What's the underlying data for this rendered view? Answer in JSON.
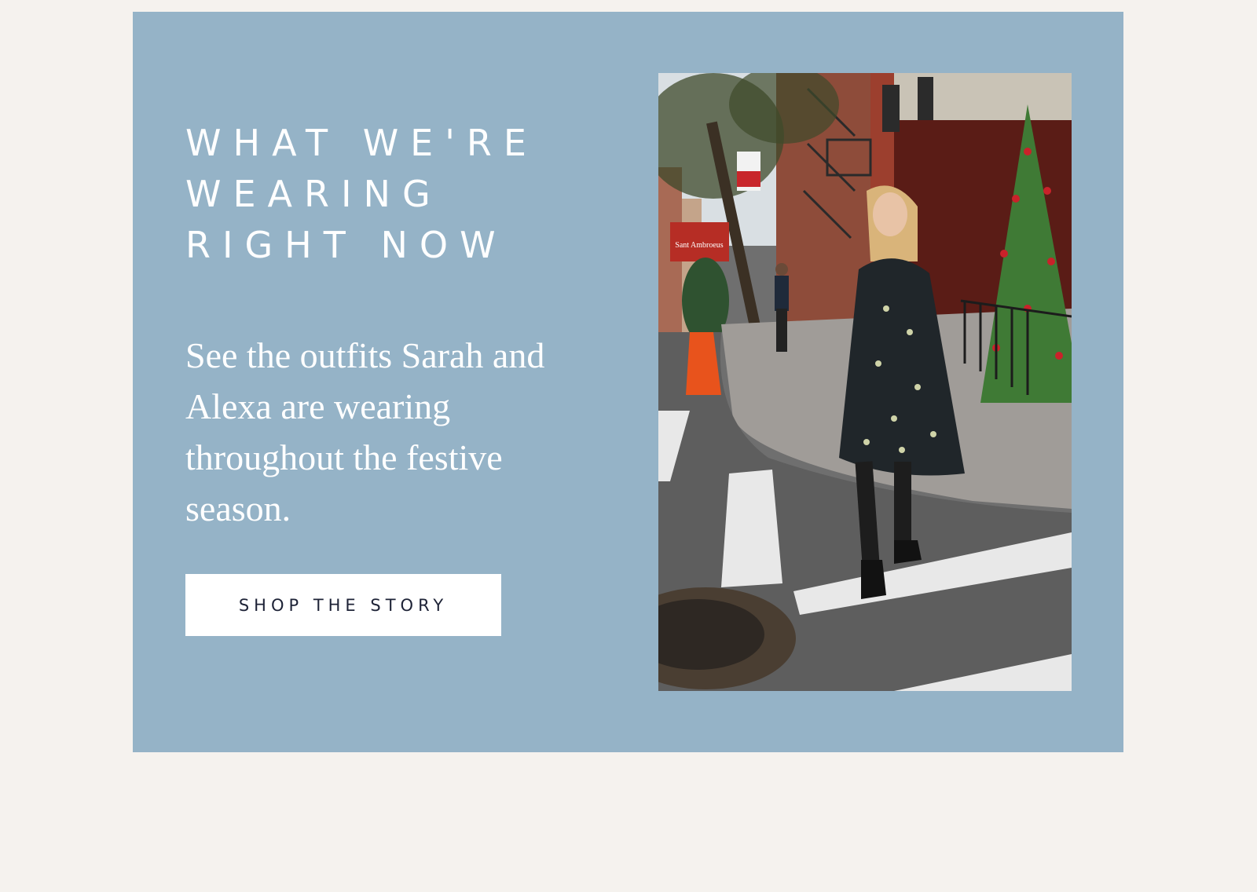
{
  "promo": {
    "heading_lines": [
      "WHAT WE'RE",
      "WEARING",
      "RIGHT NOW"
    ],
    "body": "See the outfits Sarah and Alexa are wearing throughout the festive season.",
    "button_label": "SHOP THE STORY"
  },
  "photo": {
    "storefront_sign": "Sant Ambroeus"
  },
  "colors": {
    "page_background": "#f5f2ee",
    "panel_background": "#95b3c7",
    "button_background": "#ffffff",
    "button_text": "#1d2236",
    "text_on_panel": "#ffffff"
  }
}
